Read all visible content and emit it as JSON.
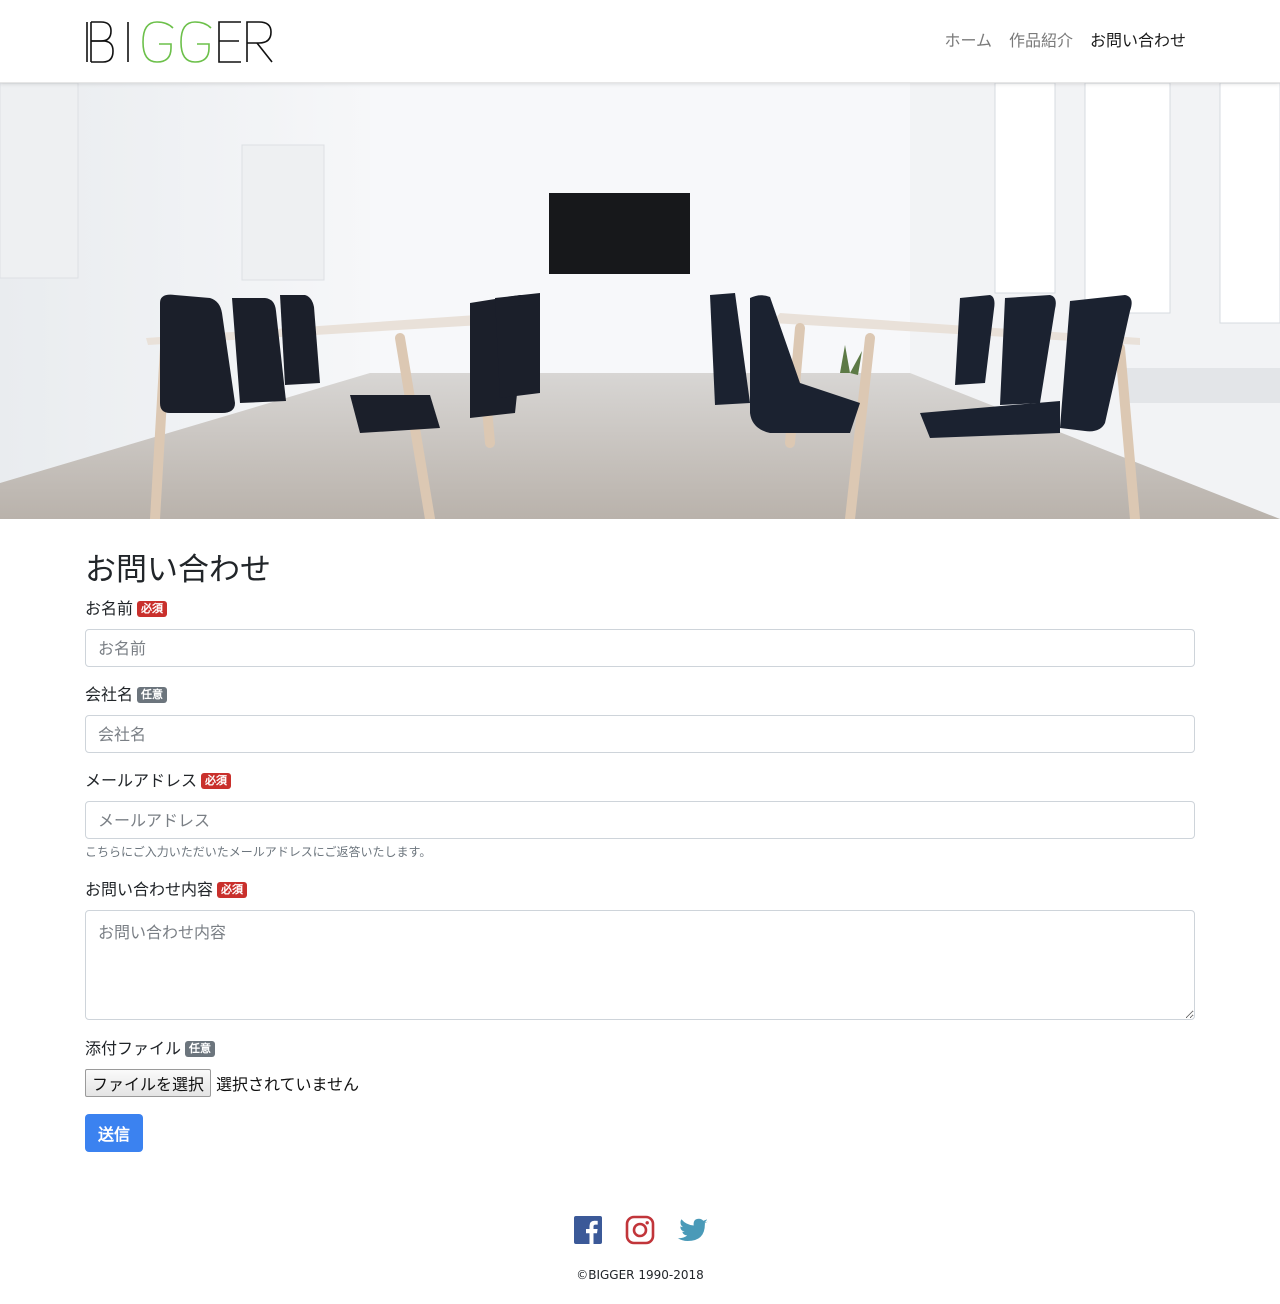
{
  "header": {
    "logo_text": "BIGGER",
    "nav": [
      {
        "label": "ホーム",
        "active": false
      },
      {
        "label": "作品紹介",
        "active": false
      },
      {
        "label": "お問い合わせ",
        "active": true
      }
    ]
  },
  "hero": {
    "image": "conference-room-photo"
  },
  "form": {
    "title": "お問い合わせ",
    "name": {
      "label": "お名前",
      "badge": "必須",
      "placeholder": "お名前"
    },
    "company": {
      "label": "会社名",
      "badge": "任意",
      "placeholder": "会社名"
    },
    "email": {
      "label": "メールアドレス",
      "badge": "必須",
      "placeholder": "メールアドレス",
      "help": "こちらにご入力いただいたメールアドレスにご返答いたします。"
    },
    "message": {
      "label": "お問い合わせ内容",
      "badge": "必須",
      "placeholder": "お問い合わせ内容"
    },
    "attachment": {
      "label": "添付ファイル",
      "badge": "任意",
      "button": "ファイルを選択",
      "status": "選択されていません"
    },
    "submit": "送信"
  },
  "footer": {
    "social": [
      {
        "name": "facebook-icon",
        "color": "#3b5998"
      },
      {
        "name": "instagram-icon",
        "color": "#c1353a"
      },
      {
        "name": "twitter-icon",
        "color": "#4a9ab8"
      }
    ],
    "copyright": "©BIGGER 1990-2018"
  },
  "colors": {
    "accent": "#3b82f0",
    "required_badge": "#c9302c",
    "optional_badge": "#6c757d",
    "logo_green": "#6cc04a"
  }
}
